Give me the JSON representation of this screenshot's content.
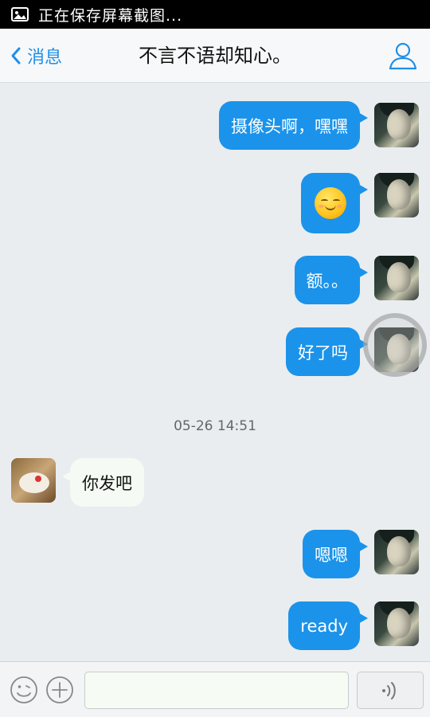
{
  "status_bar": {
    "text": "正在保存屏幕截图..."
  },
  "header": {
    "back_label": "消息",
    "title": "不言不语却知心。"
  },
  "messages": [
    {
      "dir": "out",
      "text": "摄像头啊，嘿嘿"
    },
    {
      "dir": "out",
      "emoji": "smiling-emoji"
    },
    {
      "dir": "out",
      "text": "额。。"
    },
    {
      "dir": "out",
      "text": "好了吗"
    },
    {
      "timestamp": "05-26 14:51"
    },
    {
      "dir": "in",
      "text": "你发吧"
    },
    {
      "dir": "out",
      "text": "嗯嗯"
    },
    {
      "dir": "out",
      "text": "ready"
    }
  ],
  "input": {
    "value": "",
    "placeholder": ""
  },
  "colors": {
    "bubble_out": "#1b93ea",
    "bubble_in": "#f5faf4",
    "accent": "#1e8fe8",
    "background": "#e9edf0"
  }
}
